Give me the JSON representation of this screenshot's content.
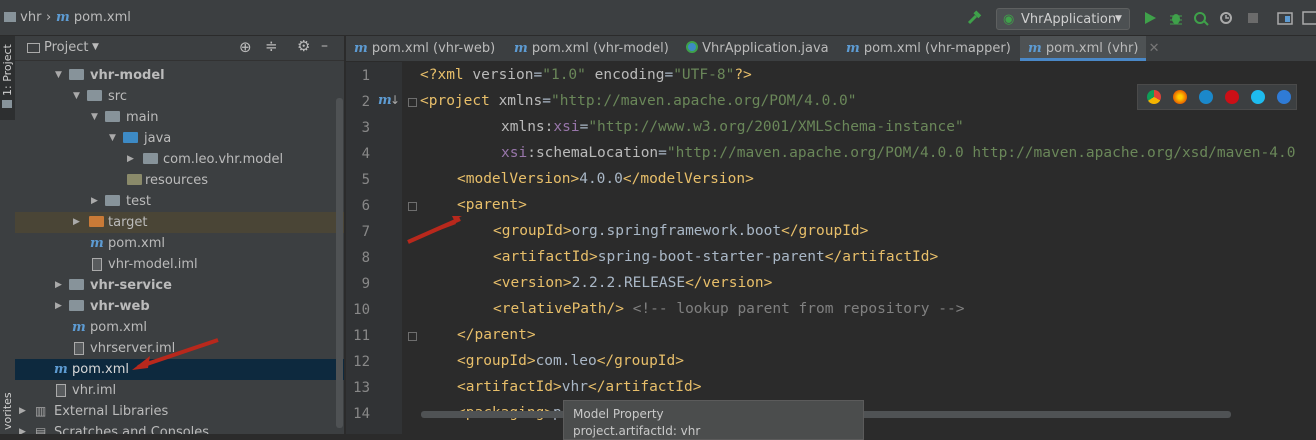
{
  "nav": {
    "project": "vhr",
    "file": "pom.xml",
    "run_config": "VhrApplication"
  },
  "stripe": {
    "project_tab": "1: Project",
    "favorites_tab": "vorites"
  },
  "panel": {
    "title": "Project",
    "tree": [
      {
        "label": "vhr-model",
        "bold": true
      },
      {
        "label": "src"
      },
      {
        "label": "main"
      },
      {
        "label": "java"
      },
      {
        "label": "com.leo.vhr.model"
      },
      {
        "label": "resources"
      },
      {
        "label": "test"
      },
      {
        "label": "target"
      },
      {
        "label": "pom.xml"
      },
      {
        "label": "vhr-model.iml"
      },
      {
        "label": "vhr-service",
        "bold": true
      },
      {
        "label": "vhr-web",
        "bold": true
      },
      {
        "label": "pom.xml"
      },
      {
        "label": "vhrserver.iml"
      },
      {
        "label": "pom.xml",
        "selected": true
      },
      {
        "label": "vhr.iml"
      },
      {
        "label": "External Libraries"
      },
      {
        "label": "Scratches and Consoles"
      }
    ]
  },
  "tabs": [
    {
      "label": "pom.xml (vhr-web)"
    },
    {
      "label": "pom.xml (vhr-model)"
    },
    {
      "label": "VhrApplication.java"
    },
    {
      "label": "pom.xml (vhr-mapper)"
    },
    {
      "label": "pom.xml (vhr)",
      "active": true
    }
  ],
  "editor": {
    "line_numbers": [
      "1",
      "2",
      "3",
      "4",
      "5",
      "6",
      "7",
      "8",
      "9",
      "10",
      "11",
      "12",
      "13",
      "14"
    ],
    "gutter_marker": "m",
    "lines": {
      "l1": {
        "open": "<?xml ",
        "attr1": "version",
        "val1": "\"1.0\"",
        "attr2": "encoding",
        "val2": "\"UTF-8\"",
        "close": "?>"
      },
      "l2": {
        "tag": "<project ",
        "attr": "xmlns",
        "val": "\"http://maven.apache.org/POM/4.0.0\""
      },
      "l3": {
        "ns": "xmlns",
        "colon": ":",
        "attr": "xsi",
        "val": "\"http://www.w3.org/2001/XMLSchema-instance\""
      },
      "l4": {
        "ns": "xsi",
        "colon": ":",
        "attr": "schemaLocation",
        "val": "\"http://maven.apache.org/POM/4.0.0 http://maven.apache.org/xsd/maven-4.0"
      },
      "l5": {
        "open": "<modelVersion>",
        "text": "4.0.0",
        "close": "</modelVersion>"
      },
      "l6": {
        "open": "<parent>"
      },
      "l7": {
        "open": "<groupId>",
        "text": "org.springframework.boot",
        "close": "</groupId>"
      },
      "l8": {
        "open": "<artifactId>",
        "text": "spring-boot-starter-parent",
        "close": "</artifactId>"
      },
      "l9": {
        "open": "<version>",
        "text": "2.2.2.RELEASE",
        "close": "</version>"
      },
      "l10": {
        "open": "<relativePath/>",
        "comment": "<!-- lookup parent from repository -->"
      },
      "l11": {
        "close": "</parent>"
      },
      "l12": {
        "open": "<groupId>",
        "text": "com.leo",
        "close": "</groupId>"
      },
      "l13": {
        "open": "<artifactId>",
        "text": "vhr",
        "close": "</artifactId>"
      },
      "l14": {
        "open": "<packaging>",
        "text": "p"
      }
    }
  },
  "tooltip": {
    "title": "Model Property",
    "line2": "project.artifactId: vhr"
  },
  "colors": {
    "accent": "#4a88c7",
    "arrow": "#b8281c",
    "selection": "#0d293e"
  }
}
